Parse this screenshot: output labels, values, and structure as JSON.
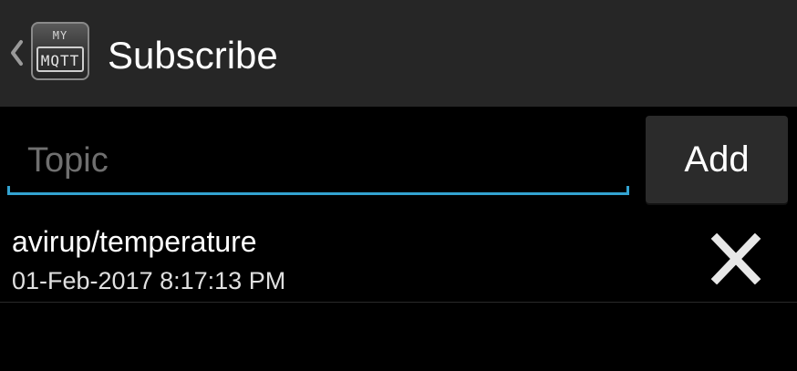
{
  "action_bar": {
    "title": "Subscribe",
    "logo": {
      "line1": "MY",
      "line2": "MQTT"
    },
    "back_icon": "chevron-left-icon",
    "background": "#262626"
  },
  "topic_input": {
    "value": "",
    "placeholder": "Topic",
    "underline_color": "#33a3d1"
  },
  "add_button": {
    "label": "Add"
  },
  "subscriptions": [
    {
      "topic": "avirup/temperature",
      "timestamp": "01-Feb-2017 8:17:13 PM",
      "remove_icon": "close-icon"
    }
  ]
}
